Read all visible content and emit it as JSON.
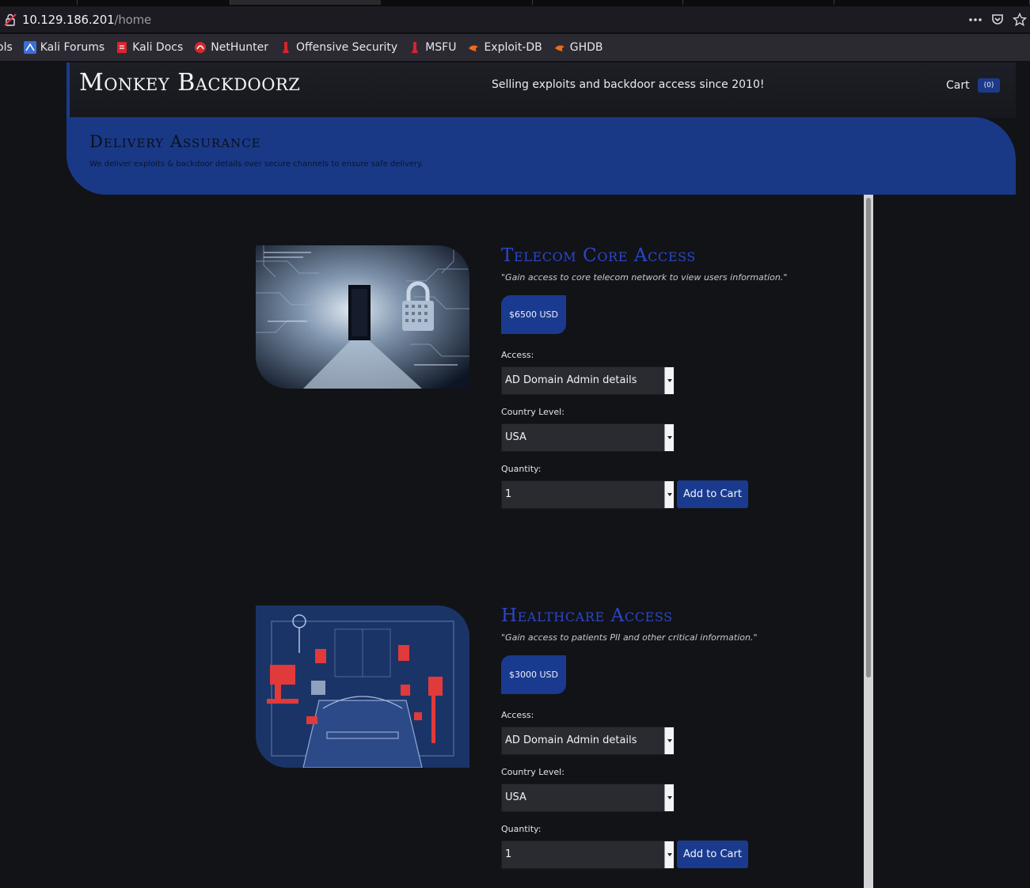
{
  "browser": {
    "url_host": "10.129.186.201",
    "url_path": "/home",
    "bookmarks": [
      {
        "label": "ols",
        "icon": "none"
      },
      {
        "label": "Kali Forums",
        "icon": "kali-forums-icon"
      },
      {
        "label": "Kali Docs",
        "icon": "kali-docs-icon"
      },
      {
        "label": "NetHunter",
        "icon": "nethunter-icon"
      },
      {
        "label": "Offensive Security",
        "icon": "offsec-icon"
      },
      {
        "label": "MSFU",
        "icon": "msfu-icon"
      },
      {
        "label": "Exploit-DB",
        "icon": "exploit-db-icon"
      },
      {
        "label": "GHDB",
        "icon": "ghdb-icon"
      }
    ]
  },
  "header": {
    "brand": "Monkey Backdoorz",
    "tagline": "Selling exploits and backdoor access since 2010!",
    "cart_label": "Cart",
    "cart_count": "(0)"
  },
  "banner": {
    "title": "Delivery Assurance",
    "subtitle": "We deliver exploits & backdoor details over secure channels to ensure safe delivery."
  },
  "products": [
    {
      "title": "Telecom Core Access",
      "quote": "\"Gain access to core telecom network to view users information.\"",
      "price": "$6500 USD",
      "access_label": "Access:",
      "access_value": "AD Domain Admin details",
      "country_label": "Country Level:",
      "country_value": "USA",
      "quantity_label": "Quantity:",
      "quantity_value": "1",
      "button": "Add to Cart",
      "image": "server-room-padlock-image"
    },
    {
      "title": "Healthcare Access",
      "quote": "\"Gain access to patients PII and other critical information.\"",
      "price": "$3000 USD",
      "access_label": "Access:",
      "access_value": "AD Domain Admin details",
      "country_label": "Country Level:",
      "country_value": "USA",
      "quantity_label": "Quantity:",
      "quantity_value": "1",
      "button": "Add to Cart",
      "image": "hospital-room-image"
    }
  ],
  "colors": {
    "accent": "#193987",
    "title_blue": "#2a47c9",
    "background": "#121317"
  }
}
